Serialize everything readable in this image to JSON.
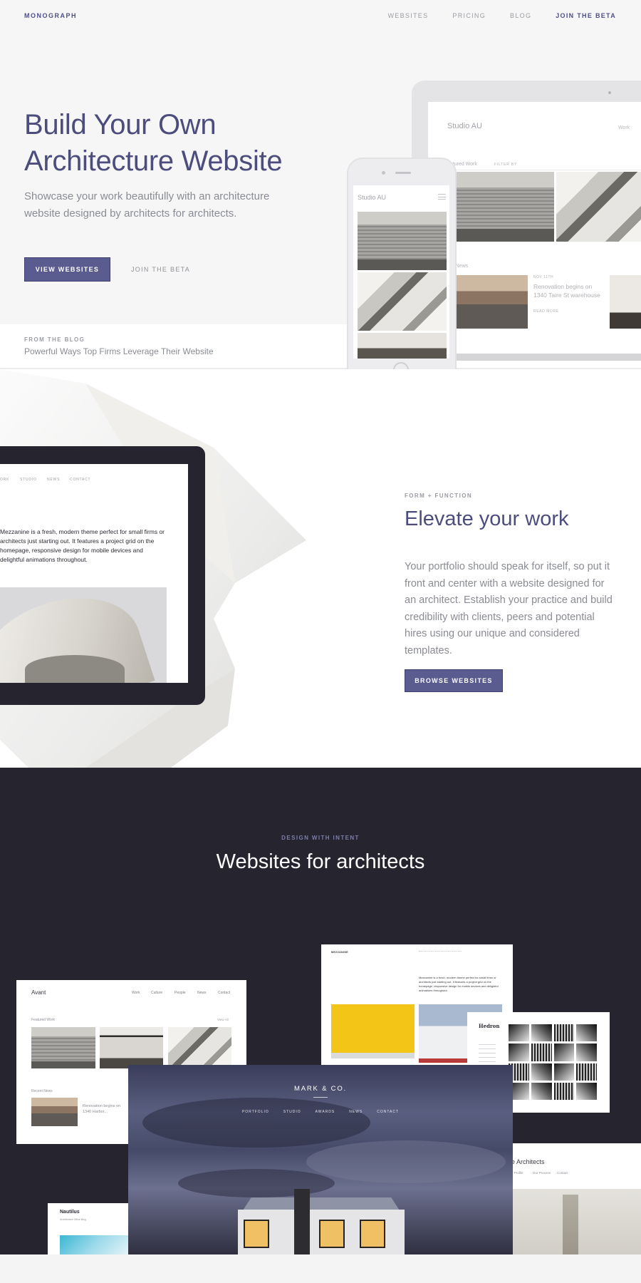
{
  "nav": {
    "logo": "MONOGRAPH",
    "links": [
      "WEBSITES",
      "PRICING",
      "BLOG",
      "JOIN THE BETA"
    ]
  },
  "hero": {
    "title": "Build Your Own Architecture Website",
    "subtitle": "Showcase your work beautifully with an architecture website designed by architects for architects.",
    "primary_button": "VIEW WEBSITES",
    "secondary_link": "JOIN THE BETA"
  },
  "blog": {
    "kicker": "FROM THE BLOG",
    "title": "Powerful Ways Top Firms Leverage Their Website"
  },
  "laptop_mock": {
    "brand": "Studio AU",
    "nav_item": "Work",
    "featured_label": "eatured Work",
    "filter_label": "FILTER BY",
    "news_label": "ent News",
    "news_date": "NOV 11TH",
    "news_title": "Renovation begins on 1340 Taire St warehouse",
    "read_more": "READ MORE"
  },
  "phone_mock": {
    "brand": "Studio AU"
  },
  "section_function": {
    "tablet_nav": [
      "ORK",
      "STUDIO",
      "NEWS",
      "CONTACT"
    ],
    "tablet_text": "Mezzanine is a fresh, modern theme perfect for small firms or architects just starting out. It features a project grid on the homepage, responsive design for mobile devices and delightful animations throughout.",
    "kicker": "FORM + FUNCTION",
    "title": "Elevate your work",
    "body": "Your portfolio should speak for itself, so put it front and center with a website designed for an architect. Establish your practice and build credibility with clients, peers and potential hires using our unique and considered templates.",
    "button": "BROWSE WEBSITES"
  },
  "section_architects": {
    "kicker": "DESIGN WITH INTENT",
    "title": "Websites for architects",
    "avant": {
      "brand": "Avant",
      "nav": [
        "Work",
        "Culture",
        "People",
        "News",
        "Contact"
      ],
      "featured_label": "Featured Work",
      "all_label": "View All",
      "news_label": "Recent News",
      "news_title": "Renovation begins on 1340 Harbor..."
    },
    "mezzanine": {
      "logo": "MEZZANINE",
      "text": "Mezzanine is a fresh, modern theme perfect for small firms or architects just starting out. It features a project grid on the homepage, responsive design for mobile devices and delightful animations throughout."
    },
    "hedron": {
      "logo": "Hedron"
    },
    "architects_site": {
      "title": "he Architects",
      "nav": [
        "Our Profile",
        "Our Process",
        "Contact"
      ]
    },
    "nautilus": {
      "title": "Nautilus",
      "nav": "Architecture   Office   Blog"
    },
    "markco": {
      "brand": "MARK & CO.",
      "nav": [
        "PORTFOLIO",
        "STUDIO",
        "AWARDS",
        "NEWS",
        "CONTACT"
      ]
    }
  },
  "colors": {
    "brand_purple": "#4c4d7c",
    "button": "#5a5b8f",
    "dark_section": "#25242f"
  }
}
